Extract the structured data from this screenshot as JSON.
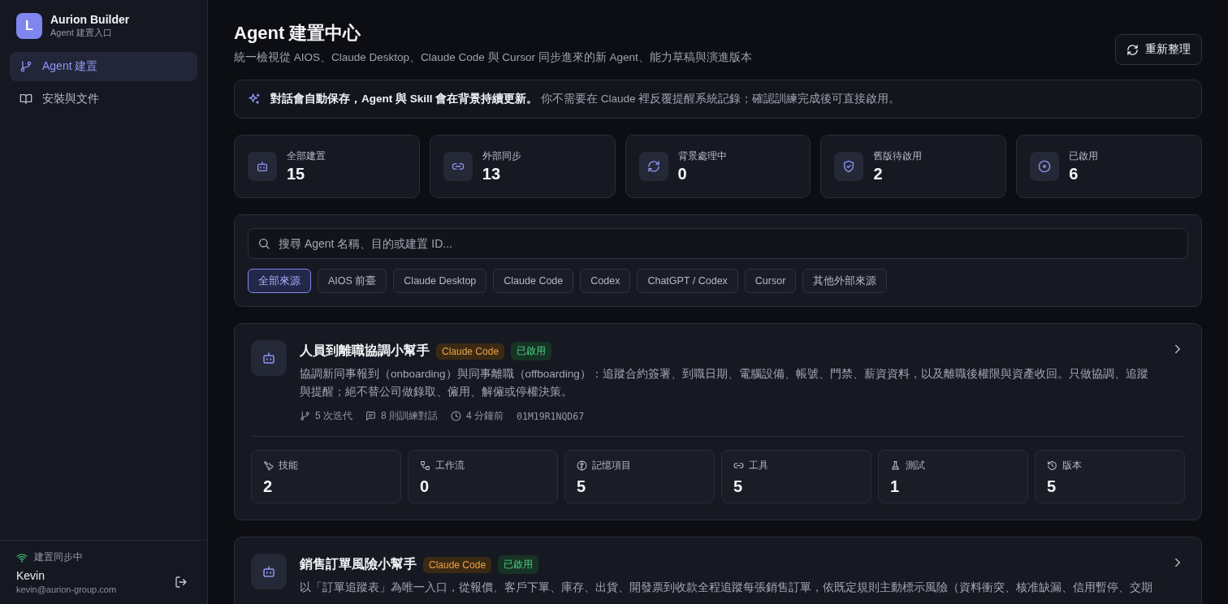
{
  "sidebar": {
    "brand": {
      "initial": "L",
      "title": "Aurion Builder",
      "subtitle": "Agent 建置入口"
    },
    "nav": [
      {
        "label": "Agent 建置",
        "selected": true
      },
      {
        "label": "安裝與文件",
        "selected": false
      }
    ],
    "sync_status": "建置同步中",
    "user": {
      "name": "Kevin",
      "email": "kevin@aurion-group.com"
    }
  },
  "header": {
    "title": "Agent 建置中心",
    "subtitle": "統一檢視從 AIOS、Claude Desktop、Claude Code 與 Cursor 同步進來的新 Agent、能力草稿與演進版本",
    "refresh_button": "重新整理"
  },
  "notice": "**對話會自動保存，Agent 與 Skill 會在背景持續更新。** 你不需要在 Claude 裡反覆提醒系統記錄；確認訓練完成後可直接啟用。",
  "stats": [
    {
      "label": "全部建置",
      "value": "15"
    },
    {
      "label": "外部同步",
      "value": "13"
    },
    {
      "label": "背景處理中",
      "value": "0"
    },
    {
      "label": "舊版待啟用",
      "value": "2"
    },
    {
      "label": "已啟用",
      "value": "6"
    }
  ],
  "search": {
    "placeholder": "搜尋 Agent 名稱、目的或建置 ID..."
  },
  "filters": [
    {
      "label": "全部來源",
      "selected": true
    },
    {
      "label": "AIOS 前臺",
      "selected": false
    },
    {
      "label": "Claude Desktop",
      "selected": false
    },
    {
      "label": "Claude Code",
      "selected": false
    },
    {
      "label": "Codex",
      "selected": false
    },
    {
      "label": "ChatGPT / Codex",
      "selected": false
    },
    {
      "label": "Cursor",
      "selected": false
    },
    {
      "label": "其他外部來源",
      "selected": false
    }
  ],
  "agents": [
    {
      "name": "人員到離職協調小幫手",
      "badges": [
        {
          "kind": "source",
          "label": "Claude Code"
        },
        {
          "kind": "status",
          "label": "已啟用"
        }
      ],
      "description": "協調新同事報到（onboarding）與同事離職（offboarding）：追蹤合約簽署、到職日期、電腦設備、帳號、門禁、薪資資料，以及離職後權限與資產收回。只做協調、追蹤與提醒；絕不替公司做錄取、僱用、解僱或停權決策。",
      "meta": {
        "iterations": "5 次迭代",
        "conversations": "8 則訓練對話",
        "updated": "4 分鐘前",
        "id": "01M19R1NQD67"
      },
      "metrics": [
        {
          "label": "技能",
          "value": "2"
        },
        {
          "label": "工作流",
          "value": "0"
        },
        {
          "label": "記憶項目",
          "value": "5"
        },
        {
          "label": "工具",
          "value": "5"
        },
        {
          "label": "測試",
          "value": "1"
        },
        {
          "label": "版本",
          "value": "5"
        }
      ]
    },
    {
      "name": "銷售訂單風險小幫手",
      "badges": [
        {
          "kind": "source",
          "label": "Claude Code"
        },
        {
          "kind": "status",
          "label": "已啟用"
        }
      ],
      "description": "以「訂單追蹤表」為唯一入口，從報價、客戶下單、庫存、出貨、開發票到收款全程追蹤每張銷售訂單，依既定規則主動標示風險（資料衝突、核准缺漏、信用暫停、交期"
    }
  ]
}
